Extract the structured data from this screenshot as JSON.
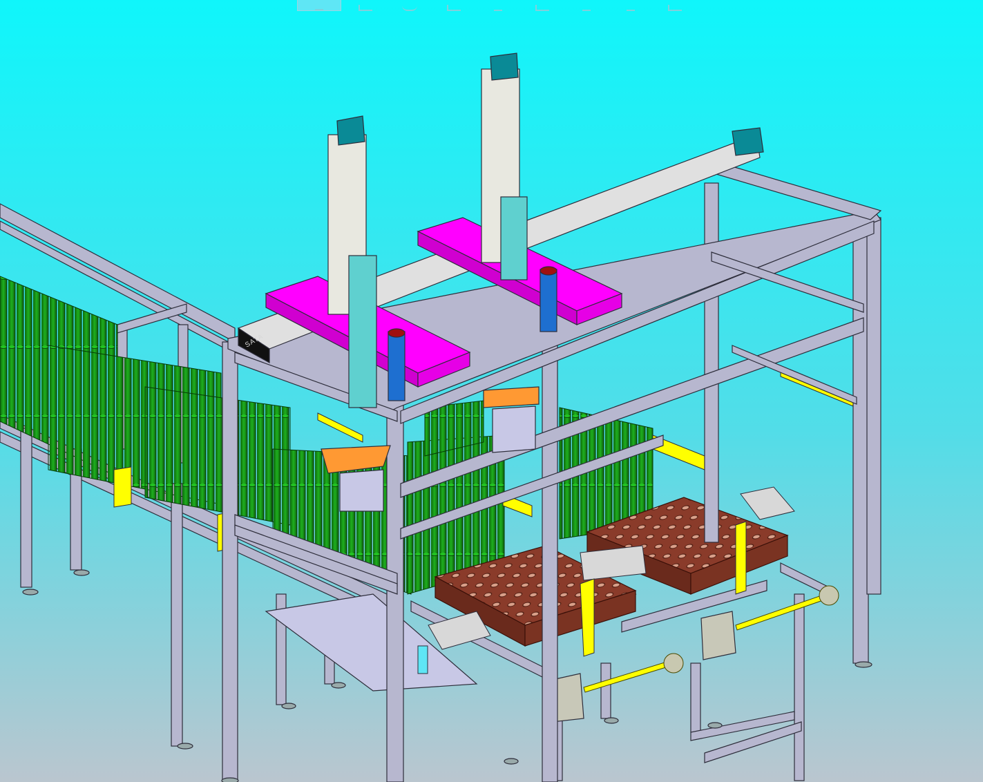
{
  "app": {
    "view": "isometric-cad-assembly",
    "background": {
      "top": "#0ff6fb",
      "mid": "#52dde8",
      "bottom": "#bac6cf"
    }
  },
  "toolbar": {
    "buttons": [
      {
        "name": "view-orientation-button",
        "icon": "view-cube-icon",
        "active": true
      },
      {
        "name": "sketch-tool-button",
        "icon": "line-icon"
      },
      {
        "name": "rotate-view-button",
        "icon": "rotate-icon"
      },
      {
        "name": "pan-button",
        "icon": "pan-icon"
      },
      {
        "name": "zoom-button",
        "icon": "zoom-icon"
      },
      {
        "name": "section-view-button",
        "icon": "section-icon"
      },
      {
        "name": "display-style-button",
        "icon": "display-style-icon"
      },
      {
        "name": "hide-show-button",
        "icon": "hide-show-icon"
      },
      {
        "name": "view-settings-button",
        "icon": "view-settings-icon"
      }
    ]
  },
  "model": {
    "actuator_brand_label": "SATA",
    "colors": {
      "frame": "#b7b7cf",
      "frame_edge": "#2d2d3a",
      "gantry_plate": "#ff00ff",
      "tubes": "#138f13",
      "trays": "#8a3b2a",
      "guards": "#ffff00",
      "motor": "#0a8a96",
      "sensor": "#1e6fd0"
    }
  }
}
